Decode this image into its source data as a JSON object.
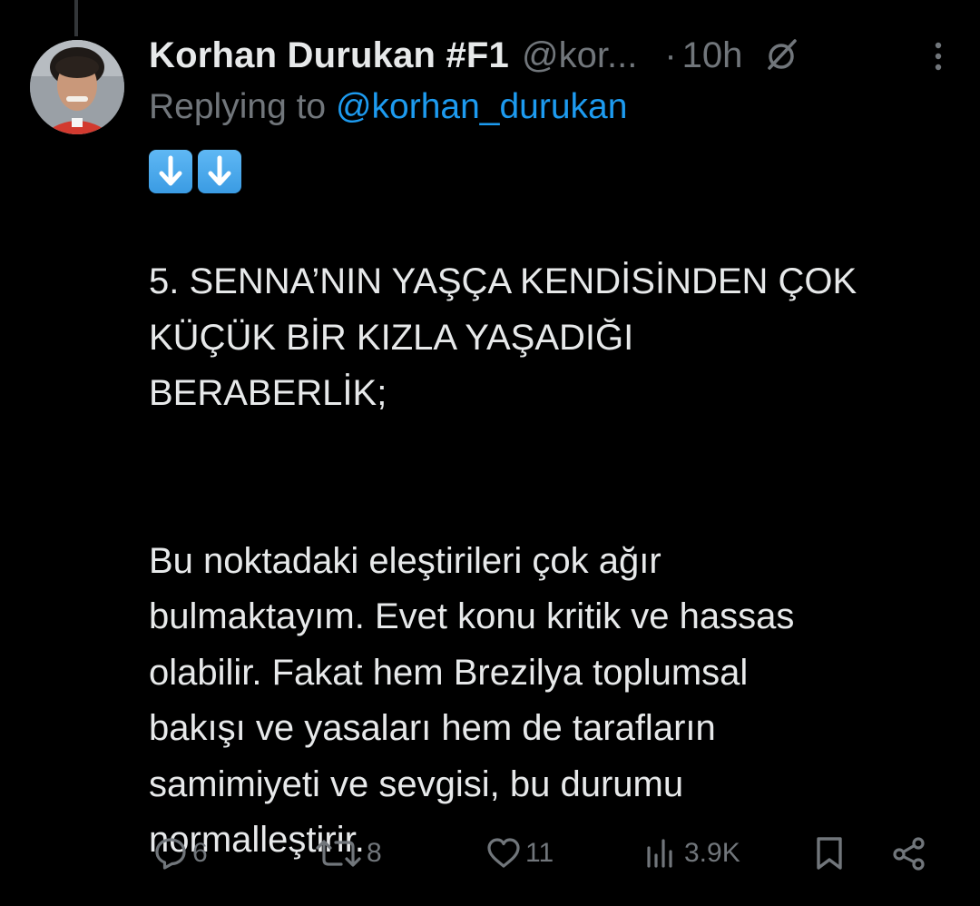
{
  "colors": {
    "background": "#000000",
    "text_primary": "#e7e9ea",
    "text_secondary": "#71767b",
    "link": "#1d9bf0",
    "thread_line": "#333639"
  },
  "tweet": {
    "author_name": "Korhan Durukan #F1",
    "author_handle": "@kor...",
    "separator": "·",
    "time": "10h",
    "replying_prefix": "Replying to ",
    "replying_handle": "@korhan_durukan",
    "emoji_icons": [
      "arrow-down-emoji",
      "arrow-down-emoji"
    ],
    "body_lines": [
      "5. SENNA’NIN YAŞÇA KENDİSİNDEN ÇOK",
      "KÜÇÜK BİR KIZLA YAŞADIĞI",
      "BERABERLİK;",
      "Bu noktadaki eleştirileri çok ağır",
      "bulmaktayım. Evet konu kritik ve hassas",
      "olabilir. Fakat hem Brezilya toplumsal",
      "bakışı ve yasaları hem de tarafların",
      "samimiyeti ve sevgisi, bu durumu",
      "normalleştirir."
    ]
  },
  "actions": {
    "reply_count": "6",
    "repost_count": "8",
    "like_count": "11",
    "views_count": "3.9K"
  }
}
